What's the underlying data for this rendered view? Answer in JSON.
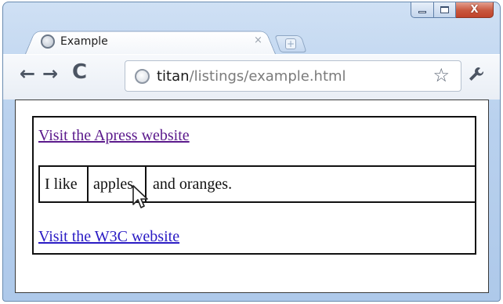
{
  "window": {
    "caption_buttons": {
      "minimize_icon": "minimize-icon",
      "maximize_icon": "maximize-icon",
      "close_icon": "close-icon",
      "close_glyph": "X"
    }
  },
  "tab": {
    "title": "Example",
    "close_glyph": "×",
    "favicon": "globe-icon"
  },
  "new_tab": {
    "glyph": "+"
  },
  "toolbar": {
    "back_glyph": "←",
    "forward_glyph": "→",
    "reload_glyph": "C",
    "star_glyph": "☆",
    "wrench_glyph": "🔧"
  },
  "omnibox": {
    "host": "titan",
    "path": "/listings/example.html"
  },
  "page": {
    "link_apress": "Visit the Apress website",
    "text_before": "I like",
    "apples": "apples",
    "text_after": "and oranges.",
    "link_w3c": "Visit the W3C website"
  },
  "colors": {
    "visited_link": "#5b1a8c",
    "link": "#2a1bc4",
    "frame": "#b9d1ee",
    "close_button": "#c8563d"
  }
}
